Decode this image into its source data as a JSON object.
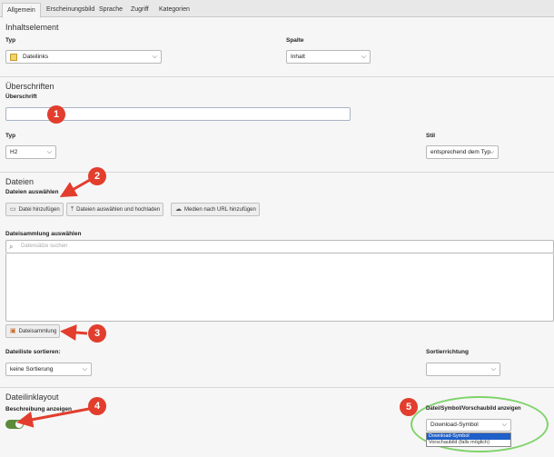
{
  "tabs": [
    "Allgemein",
    "Erscheinungsbild",
    "Sprache",
    "Zugriff",
    "Kategorien"
  ],
  "inhaltselement": {
    "title": "Inhaltselement",
    "typ_label": "Typ",
    "typ_value": "Dateilinks",
    "spalte_label": "Spalte",
    "spalte_value": "Inhalt"
  },
  "ueberschriften": {
    "title": "Überschriften",
    "ueberschrift_label": "Überschrift",
    "ueberschrift_value": "",
    "typ_label": "Typ",
    "typ_value": "H2",
    "stil_label": "Stil",
    "stil_value": "entsprechend dem Typ"
  },
  "dateien": {
    "title": "Dateien",
    "auswaehlen_label": "Dateien auswählen",
    "btn_add": "Datei hinzufügen",
    "btn_upload": "Dateien auswählen und hochladen",
    "btn_url": "Medien nach URL hinzufügen",
    "sammlung_label": "Dateisammlung auswählen",
    "search_placeholder": "Datensätze suchen",
    "sammlung_btn": "Dateisammlung",
    "sortieren_label": "Dateiliste sortieren:",
    "sortieren_value": "keine Sortierung",
    "richtung_label": "Sortierrichtung",
    "richtung_value": ""
  },
  "layout": {
    "title": "Dateilinklayout",
    "beschreibung_label": "Beschreibung anzeigen",
    "beschreibung_on": true,
    "symbol_label": "Datei/Symbol/Vorschaubild anzeigen",
    "symbol_value": "Download-Symbol",
    "symbol_options": [
      "Download-Symbol",
      "Vorschaubild (falls möglich)"
    ]
  },
  "badges": [
    "1",
    "2",
    "3",
    "4",
    "5"
  ],
  "colors": {
    "badge": "#e23d2d",
    "highlight": "#7fd36a",
    "toggle": "#5b8a39"
  }
}
